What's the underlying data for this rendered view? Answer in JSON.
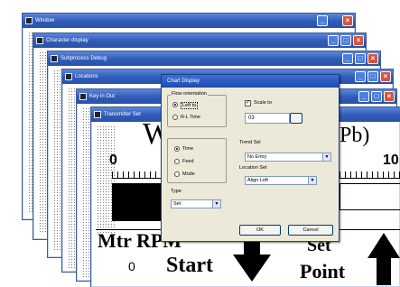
{
  "windows": [
    {
      "id": "w1",
      "title": "Window"
    },
    {
      "id": "w2",
      "title": "Character display"
    },
    {
      "id": "w3",
      "title": "Subprocess Debug"
    },
    {
      "id": "w4",
      "title": "Locations"
    },
    {
      "id": "w5",
      "title": "Key in Out"
    },
    {
      "id": "w6",
      "title": "Transmitter Set"
    }
  ],
  "content": {
    "col_w": "W",
    "unit_pb": "(Pb)",
    "scale_zero": "0",
    "scale_hundred": "10",
    "mtr_label": "Mtr RPM",
    "mtr_value": "0",
    "start_label": "Start",
    "set_point_line1": "Set",
    "set_point_line2": "Point"
  },
  "dialog": {
    "title": "Chart Display",
    "group_direction": "Flow orientation",
    "radio_left_to_right": "Left to",
    "radio_right_to_left": "R-L Time",
    "check_scale": "Scale to",
    "scale_value": "03",
    "radio_time": "Time",
    "radio_feed": "Feed",
    "radio_mode": "Mode",
    "label_tag_sel": "Trend Sel",
    "select_tag_value": "No Entry",
    "label_location": "Location Set",
    "select_location_value": "Align Left",
    "label_type": "Type",
    "select_type_value": "Set",
    "ok_label": "OK",
    "cancel_label": "Cancel"
  },
  "colors": {
    "titlebar": "#2f5bb8",
    "close": "#d9533a",
    "dialog_bg": "#ece9d8"
  }
}
